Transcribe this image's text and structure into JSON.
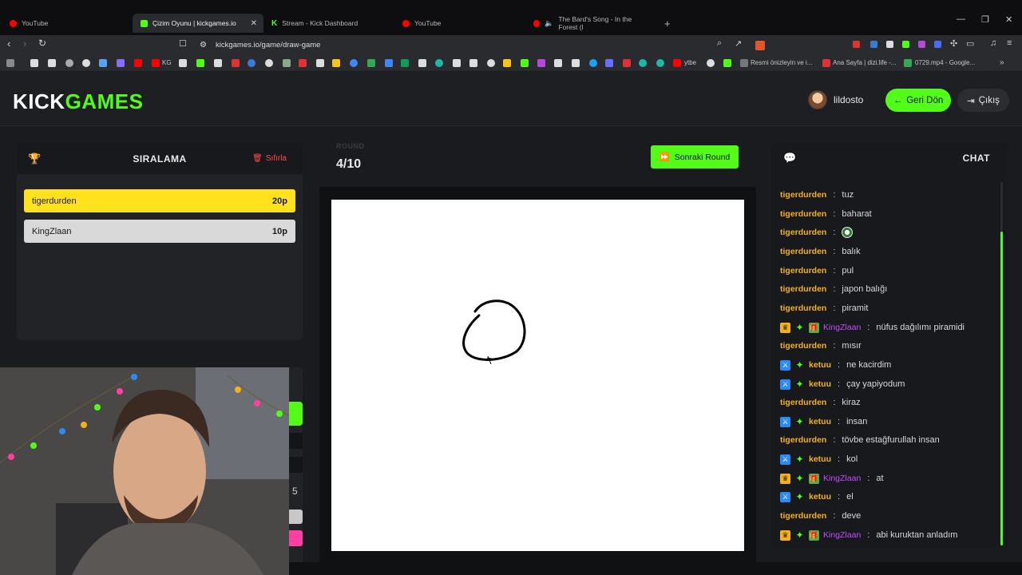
{
  "browser": {
    "tabs": [
      {
        "label": "YouTube",
        "color": "#ff0000"
      },
      {
        "label": "Çizim Oyunu | kickgames.io",
        "color": "#53fc18",
        "active": true
      },
      {
        "label": "Stream - Kick Dashboard",
        "color": "#53fc18"
      },
      {
        "label": "YouTube",
        "color": "#ff0000"
      },
      {
        "label": "The Bard's Song - In the Forest (l",
        "color": "#ff0000"
      }
    ],
    "new_tab": "+",
    "url": "kickgames.io/game/draw-game",
    "bookmarks_text": [
      "KG",
      "ytbe",
      "Resmi önizleyin ve i...",
      "Ana Sayfa | dizi.life -...",
      "0729.mp4 - Google..."
    ]
  },
  "header": {
    "logo_white": "KICK",
    "logo_green": "GAMES",
    "username": "lildosto",
    "back_label": "Geri Dön",
    "logout_label": "Çıkış"
  },
  "leaderboard": {
    "title": "SIRALAMA",
    "reset_label": "Sıfırla",
    "rows": [
      {
        "name": "tigerdurden",
        "points": "20p",
        "bg": "#ffe21d",
        "fg": "#1a1a1a"
      },
      {
        "name": "KingZlaan",
        "points": "10p",
        "bg": "#d9d9d9",
        "fg": "#1a1a1a"
      }
    ]
  },
  "left_partial": {
    "number": "5"
  },
  "round": {
    "label": "ROUND",
    "value": "4/10",
    "next_label": "Sonraki Round"
  },
  "chat": {
    "title": "CHAT",
    "messages": [
      {
        "user": "tigerdurden",
        "text": "tuz",
        "badges": []
      },
      {
        "user": "tigerdurden",
        "text": "baharat",
        "badges": []
      },
      {
        "user": "tigerdurden",
        "text": "",
        "emote": true,
        "badges": []
      },
      {
        "user": "tigerdurden",
        "text": "balık",
        "badges": []
      },
      {
        "user": "tigerdurden",
        "text": "pul",
        "badges": []
      },
      {
        "user": "tigerdurden",
        "text": "japon balığı",
        "badges": []
      },
      {
        "user": "tigerdurden",
        "text": "piramit",
        "badges": []
      },
      {
        "user": "KingZlaan",
        "text": "nüfus dağılımı piramidi",
        "badges": [
          "crown",
          "star",
          "gift"
        ]
      },
      {
        "user": "tigerdurden",
        "text": "mısır",
        "badges": []
      },
      {
        "user": "ketuu",
        "text": "ne kacirdim",
        "badges": [
          "mod",
          "star"
        ]
      },
      {
        "user": "ketuu",
        "text": "çay yapiyodum",
        "badges": [
          "mod",
          "star"
        ]
      },
      {
        "user": "tigerdurden",
        "text": "kiraz",
        "badges": []
      },
      {
        "user": "ketuu",
        "text": "insan",
        "badges": [
          "mod",
          "star"
        ]
      },
      {
        "user": "tigerdurden",
        "text": "tövbe estağfurullah insan",
        "badges": []
      },
      {
        "user": "ketuu",
        "text": "kol",
        "badges": [
          "mod",
          "star"
        ]
      },
      {
        "user": "KingZlaan",
        "text": "at",
        "badges": [
          "crown",
          "star",
          "gift"
        ]
      },
      {
        "user": "ketuu",
        "text": "el",
        "badges": [
          "mod",
          "star"
        ]
      },
      {
        "user": "tigerdurden",
        "text": "deve",
        "badges": []
      },
      {
        "user": "KingZlaan",
        "text": "abi kuruktan anladım",
        "badges": [
          "crown",
          "star",
          "gift"
        ]
      }
    ]
  },
  "colors": {
    "accent": "#53fc18",
    "danger": "#ff4d4d",
    "gold": "#f5b11b",
    "purple": "#c54bff"
  }
}
